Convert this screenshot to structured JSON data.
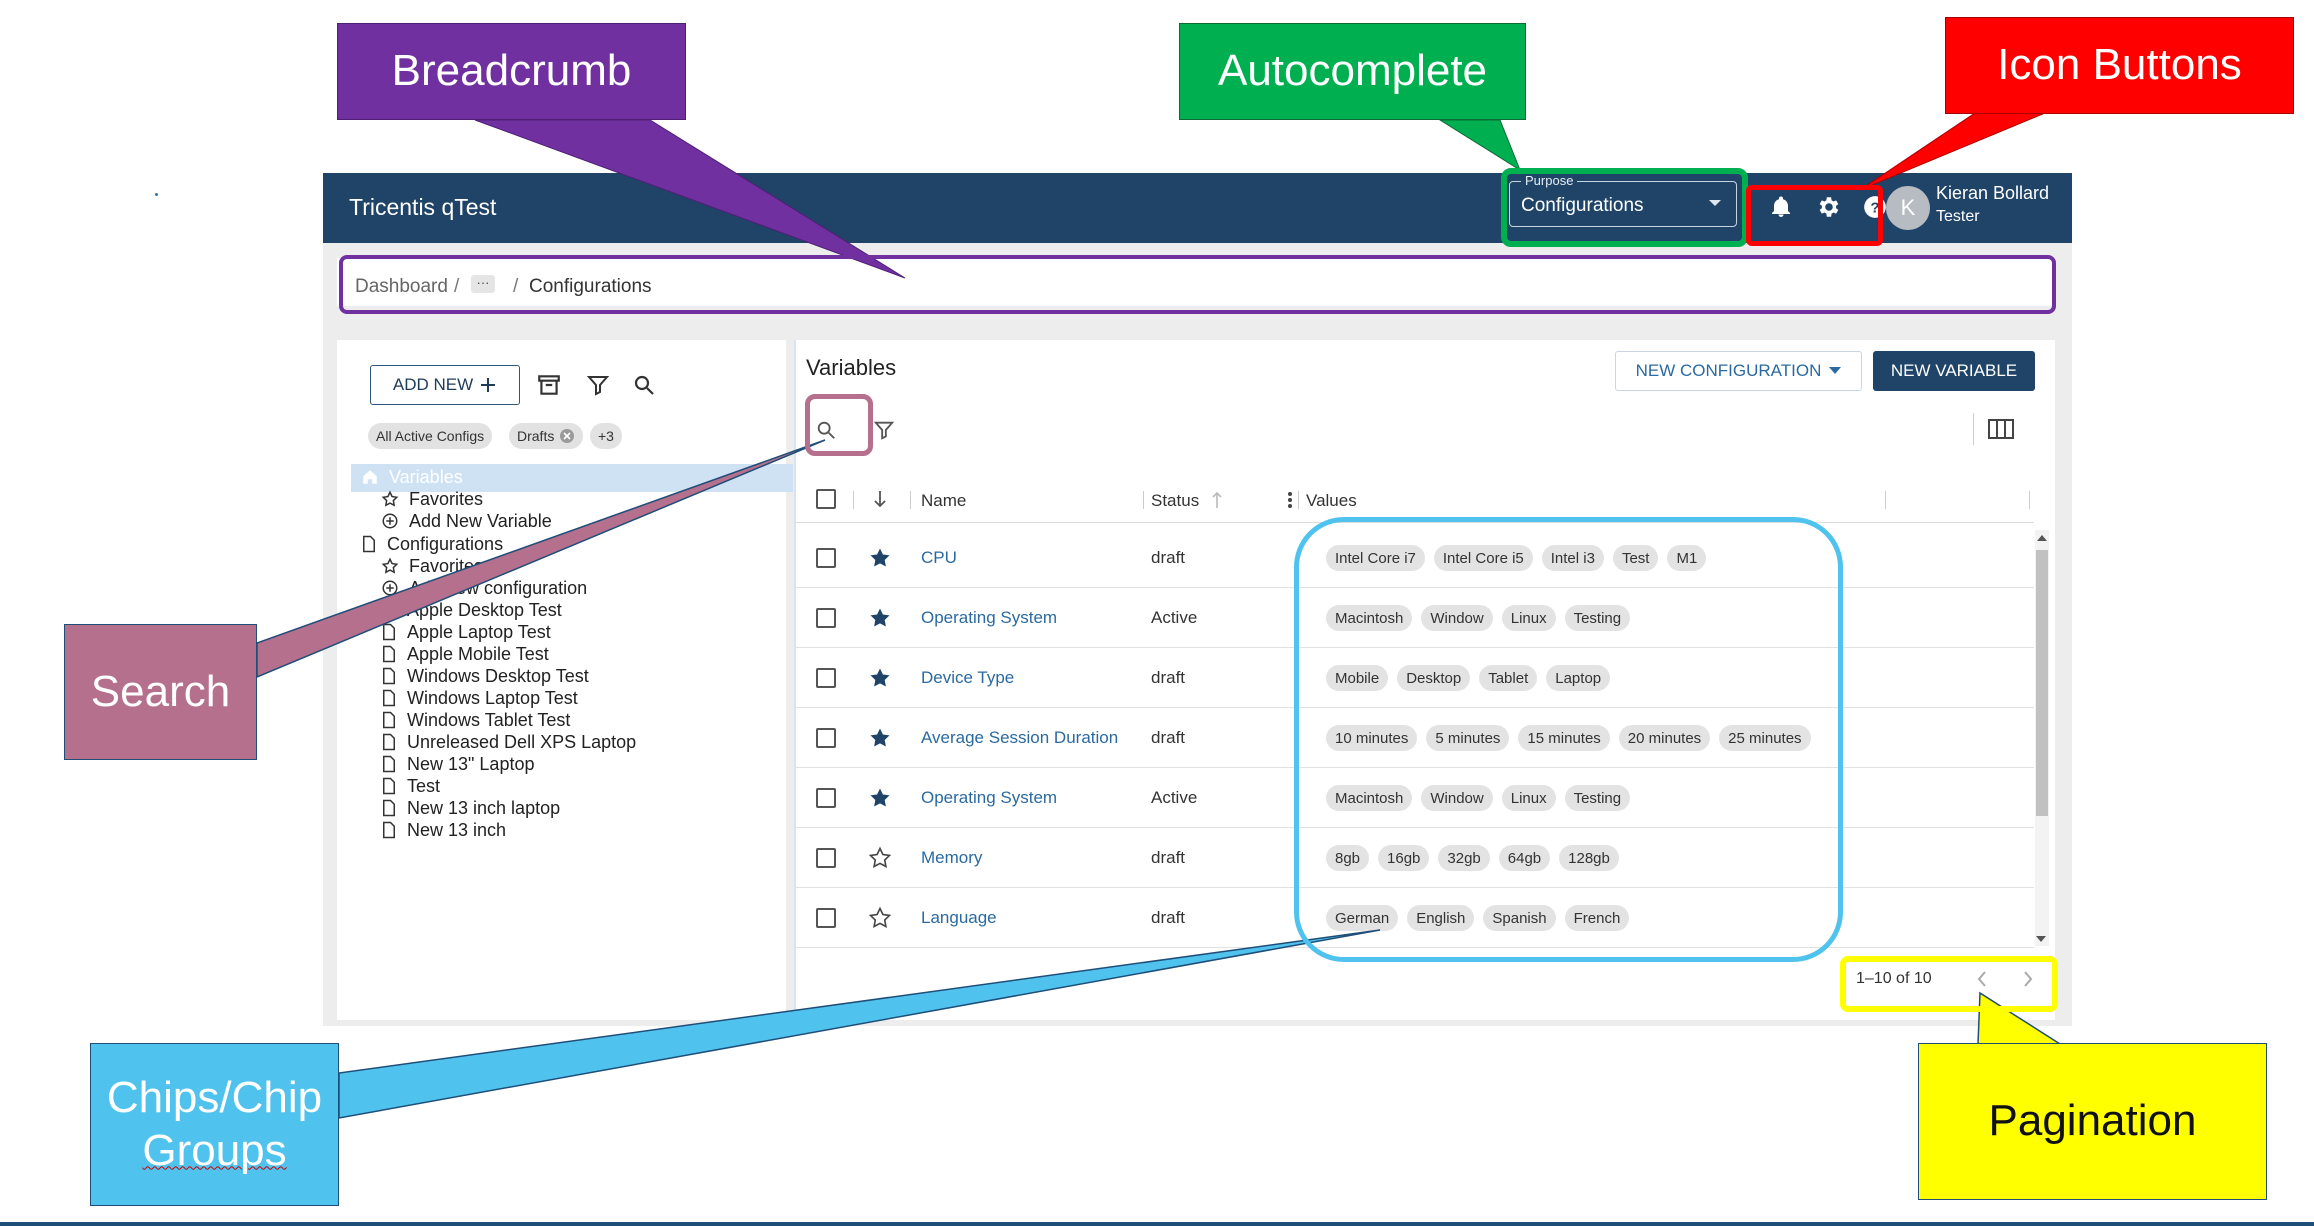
{
  "annotations": {
    "breadcrumb": "Breadcrumb",
    "autocomplete": "Autocomplete",
    "icon_buttons": "Icon Buttons",
    "search": "Search",
    "chips_line1": "Chips/Chip",
    "chips_line2": "Groups",
    "pagination": "Pagination"
  },
  "header": {
    "title": "Tricentis qTest",
    "purpose_label": "Purpose",
    "purpose_value": "Configurations",
    "icons": [
      "bell-icon",
      "gear-icon",
      "help-icon"
    ],
    "user_initial": "K",
    "user_name": "Kieran Bollard",
    "user_role": "Tester"
  },
  "breadcrumb": {
    "root": "Dashboard",
    "separator": "/",
    "more": "···",
    "current": "Configurations"
  },
  "left_panel": {
    "add_new_label": "ADD NEW",
    "filter_chips": [
      "All Active Configs",
      "Drafts",
      "+3"
    ],
    "tree": [
      {
        "label": "Variables",
        "icon": "home-icon",
        "level": 0,
        "selected": true
      },
      {
        "label": "Favorites",
        "icon": "star-outline-icon",
        "level": 1
      },
      {
        "label": "Add New Variable",
        "icon": "add-circle-icon",
        "level": 1
      },
      {
        "label": "Configurations",
        "icon": "document-icon",
        "level": 0
      },
      {
        "label": "Favorites",
        "icon": "star-outline-icon",
        "level": 1
      },
      {
        "label": "Add new configuration",
        "icon": "add-circle-icon",
        "level": 1
      },
      {
        "label": "Apple Desktop Test",
        "icon": "document-icon",
        "level": 1
      },
      {
        "label": "Apple Laptop Test",
        "icon": "document-icon",
        "level": 1
      },
      {
        "label": "Apple Mobile Test",
        "icon": "document-icon",
        "level": 1
      },
      {
        "label": "Windows Desktop Test",
        "icon": "document-icon",
        "level": 1
      },
      {
        "label": "Windows Laptop Test",
        "icon": "document-icon",
        "level": 1
      },
      {
        "label": "Windows Tablet Test",
        "icon": "document-icon",
        "level": 1
      },
      {
        "label": "Unreleased Dell XPS Laptop",
        "icon": "document-icon",
        "level": 1
      },
      {
        "label": "New 13\" Laptop",
        "icon": "document-icon",
        "level": 1
      },
      {
        "label": "Test",
        "icon": "document-icon",
        "level": 1
      },
      {
        "label": "New 13 inch laptop",
        "icon": "document-icon",
        "level": 1
      },
      {
        "label": "New 13 inch",
        "icon": "document-icon",
        "level": 1
      }
    ]
  },
  "main": {
    "title": "Variables",
    "new_configuration_label": "NEW CONFIGURATION",
    "new_variable_label": "NEW VARIABLE",
    "columns": {
      "name": "Name",
      "status": "Status",
      "values": "Values"
    },
    "rows": [
      {
        "favorite": true,
        "name": "CPU",
        "status": "draft",
        "values": [
          "Intel Core i7",
          "Intel Core i5",
          "Intel i3",
          "Test",
          "M1"
        ]
      },
      {
        "favorite": true,
        "name": "Operating System",
        "status": "Active",
        "values": [
          "Macintosh",
          "Window",
          "Linux",
          "Testing"
        ]
      },
      {
        "favorite": true,
        "name": "Device Type",
        "status": "draft",
        "values": [
          "Mobile",
          "Desktop",
          "Tablet",
          "Laptop"
        ]
      },
      {
        "favorite": true,
        "name": "Average Session Duration",
        "status": "draft",
        "values": [
          "10 minutes",
          "5 minutes",
          "15 minutes",
          "20 minutes",
          "25 minutes"
        ]
      },
      {
        "favorite": true,
        "name": "Operating System",
        "status": "Active",
        "values": [
          "Macintosh",
          "Window",
          "Linux",
          "Testing"
        ]
      },
      {
        "favorite": false,
        "name": "Memory",
        "status": "draft",
        "values": [
          "8gb",
          "16gb",
          "32gb",
          "64gb",
          "128gb"
        ]
      },
      {
        "favorite": false,
        "name": "Language",
        "status": "draft",
        "values": [
          "German",
          "English",
          "Spanish",
          "French"
        ]
      }
    ],
    "pagination": "1–10 of 10"
  },
  "colors": {
    "header_bg": "#1f4468",
    "link": "#2b6aa0",
    "breadcrumb_callout": "#7030a0",
    "autocomplete_callout": "#00b050",
    "icon_buttons_callout": "#ff0000",
    "search_callout": "#b5708d",
    "chips_callout": "#4fc3ee",
    "pagination_callout": "#ffff00"
  }
}
